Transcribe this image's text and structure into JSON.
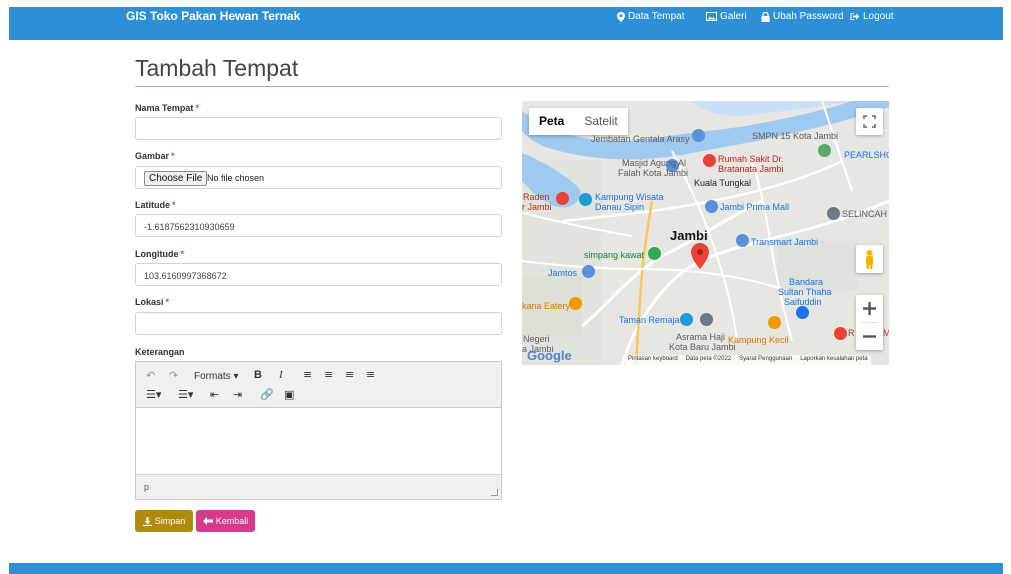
{
  "navbar": {
    "brand": "GIS Toko Pakan Hewan Ternak",
    "items": [
      {
        "label": "Data Tempat",
        "icon": "map-marker-icon"
      },
      {
        "label": "Galeri",
        "icon": "image-icon"
      },
      {
        "label": "Ubah Password",
        "icon": "lock-icon"
      },
      {
        "label": "Logout",
        "icon": "logout-icon"
      }
    ]
  },
  "page": {
    "title": "Tambah Tempat"
  },
  "form": {
    "required_mark": "*",
    "nama": {
      "label": "Nama Tempat",
      "value": ""
    },
    "gambar": {
      "label": "Gambar",
      "button": "Choose File",
      "status": "No file chosen"
    },
    "latitude": {
      "label": "Latitude",
      "value": "-1.6187562310930659"
    },
    "longitude": {
      "label": "Longitude",
      "value": "103.6160997368672"
    },
    "lokasi": {
      "label": "Lokasi",
      "value": ""
    },
    "keterangan": {
      "label": "Keterangan",
      "formats": "Formats",
      "status_path": "p"
    }
  },
  "buttons": {
    "save": "Simpan",
    "back": "Kembali"
  },
  "map": {
    "tabs": [
      "Peta",
      "Satelit"
    ],
    "labels": {
      "jembatan": "Jembatan Gentala Arasy",
      "smpn": "SMPN 15 Kota Jambi",
      "pearlsh": "PEARLSHO",
      "masjid1": "Masjid Agung Al",
      "masjid2": "Falah Kota Jambi",
      "rs1": "Rumah Sakit Dr.",
      "rs2": "Bratanata Jambi",
      "kuala": "Kuala Tungkal",
      "raden1": "Raden",
      "raden2": "r Jambi",
      "kampung1": "Kampung Wisata",
      "kampung2": "Danau Sipin",
      "prima": "Jambi Prima Mall",
      "selincah": "SELINCAH",
      "city": "Jambi",
      "transmart": "Transmart Jambi",
      "simpang": "simpang kawat",
      "jamtos": "Jamtos",
      "bandara1": "Bandara",
      "bandara2": "Sultan Thaha",
      "bandara3": "Saifuddin",
      "kana": "kana Eatery",
      "taman": "Taman Remaja",
      "negeri1": "Negeri",
      "negeri2": "a Jambi",
      "asrama1": "Asrama Haji",
      "asrama2": "Kota Baru Jambi",
      "kampungkecil": "Kampung Kecil",
      "redm": "R",
      "redm2": "M"
    },
    "google": "Google",
    "attribution": [
      "Pintasan keyboard",
      "Data peta ©2022",
      "Syarat Penggunaan",
      "Laporkan kesalahan peta"
    ]
  }
}
